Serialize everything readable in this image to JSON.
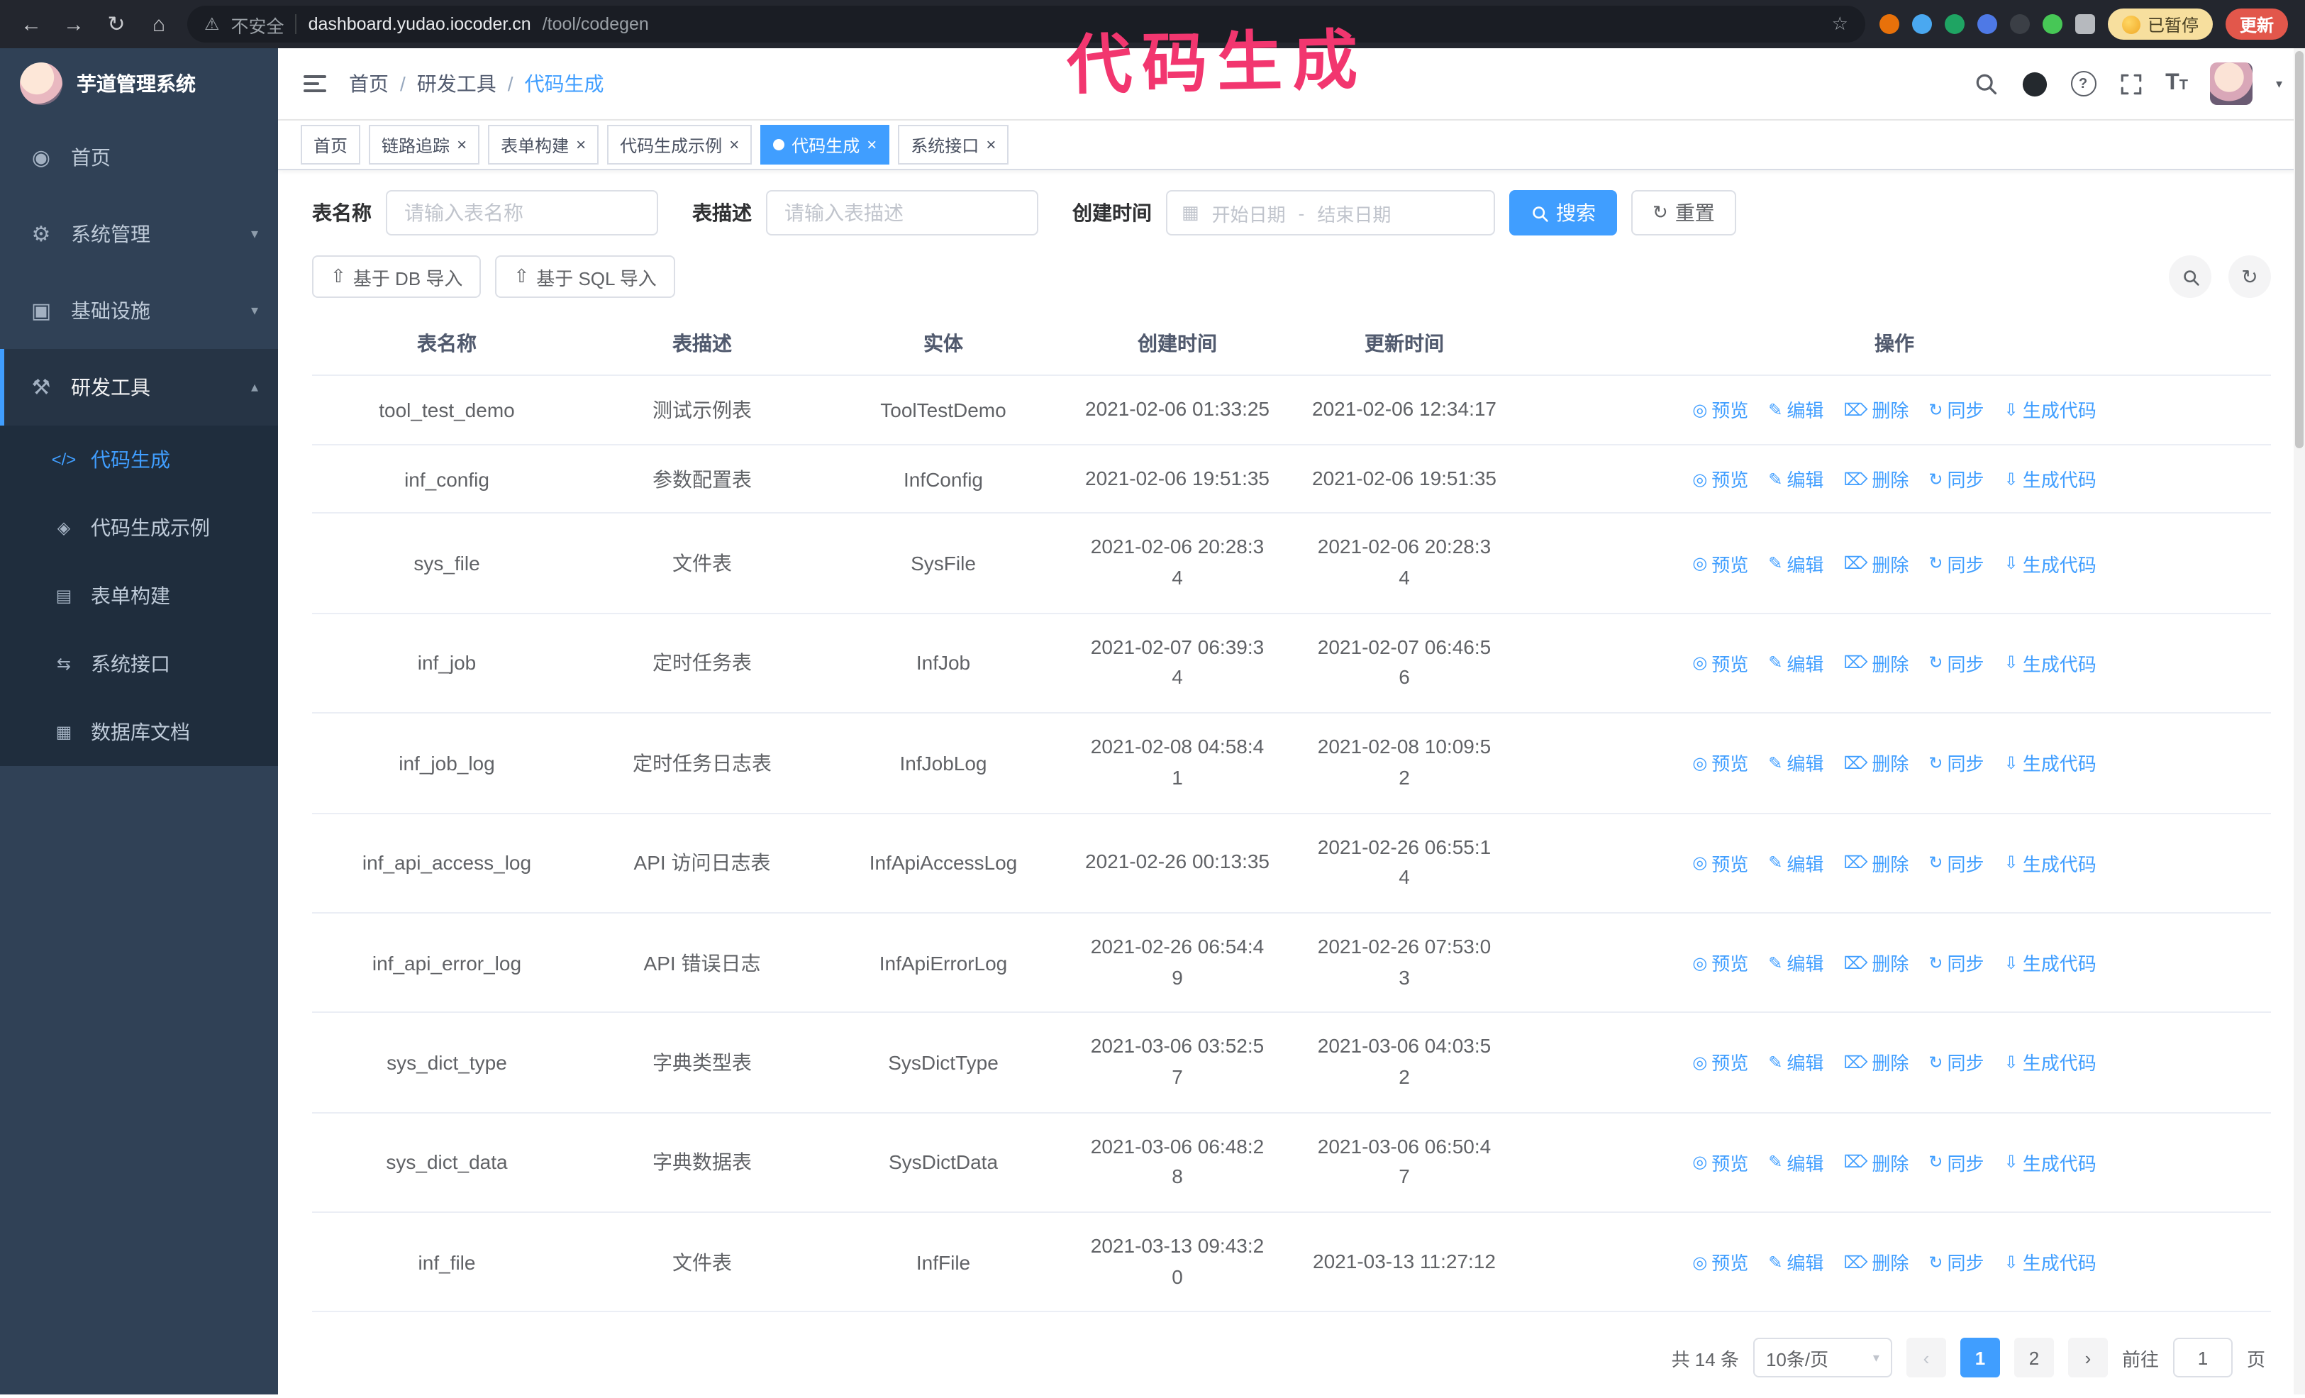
{
  "colors": {
    "primary": "#409eff",
    "annotation": "#f2366f",
    "sidebar_bg": "#304156",
    "submenu_bg": "#1f2d3d"
  },
  "annotation": {
    "text": "代码生成"
  },
  "browser": {
    "security_label": "不安全",
    "url_domain": "dashboard.yudao.iocoder.cn",
    "url_path": "/tool/codegen",
    "paused_badge": "已暂停",
    "update_button": "更新"
  },
  "sidebar": {
    "logo_title": "芋道管理系统",
    "items": [
      {
        "label": "首页"
      },
      {
        "label": "系统管理"
      },
      {
        "label": "基础设施"
      },
      {
        "label": "研发工具",
        "children": [
          {
            "label": "代码生成"
          },
          {
            "label": "代码生成示例"
          },
          {
            "label": "表单构建"
          },
          {
            "label": "系统接口"
          },
          {
            "label": "数据库文档"
          }
        ]
      }
    ]
  },
  "header": {
    "breadcrumb": [
      "首页",
      "研发工具",
      "代码生成"
    ],
    "separator": "/"
  },
  "tabs": [
    {
      "label": "首页"
    },
    {
      "label": "链路追踪"
    },
    {
      "label": "表单构建"
    },
    {
      "label": "代码生成示例"
    },
    {
      "label": "代码生成"
    },
    {
      "label": "系统接口"
    }
  ],
  "filters": {
    "table_name_label": "表名称",
    "table_name_placeholder": "请输入表名称",
    "table_desc_label": "表描述",
    "table_desc_placeholder": "请输入表描述",
    "create_time_label": "创建时间",
    "date_start_placeholder": "开始日期",
    "date_separator": "-",
    "date_end_placeholder": "结束日期",
    "search_button": "搜索",
    "reset_button": "重置"
  },
  "toolbar": {
    "import_db_label": "基于 DB 导入",
    "import_sql_label": "基于 SQL 导入"
  },
  "table": {
    "columns": [
      "表名称",
      "表描述",
      "实体",
      "创建时间",
      "更新时间",
      "操作"
    ],
    "actions": [
      {
        "name": "preview",
        "label": "预览",
        "icon": "eye-icon"
      },
      {
        "name": "edit",
        "label": "编辑",
        "icon": "edit-icon"
      },
      {
        "name": "delete",
        "label": "删除",
        "icon": "delete-icon"
      },
      {
        "name": "sync",
        "label": "同步",
        "icon": "sync-icon"
      },
      {
        "name": "generate-code",
        "label": "生成代码",
        "icon": "download-icon"
      }
    ],
    "rows": [
      {
        "name": "tool_test_demo",
        "desc": "测试示例表",
        "entity": "ToolTestDemo",
        "created": "2021-02-06 01:33:25",
        "updated": "2021-02-06 12:34:17"
      },
      {
        "name": "inf_config",
        "desc": "参数配置表",
        "entity": "InfConfig",
        "created": "2021-02-06 19:51:35",
        "updated": "2021-02-06 19:51:35"
      },
      {
        "name": "sys_file",
        "desc": "文件表",
        "entity": "SysFile",
        "created": "2021-02-06 20:28:3\n4",
        "updated": "2021-02-06 20:28:3\n4"
      },
      {
        "name": "inf_job",
        "desc": "定时任务表",
        "entity": "InfJob",
        "created": "2021-02-07 06:39:3\n4",
        "updated": "2021-02-07 06:46:5\n6"
      },
      {
        "name": "inf_job_log",
        "desc": "定时任务日志表",
        "entity": "InfJobLog",
        "created": "2021-02-08 04:58:4\n1",
        "updated": "2021-02-08 10:09:5\n2"
      },
      {
        "name": "inf_api_access_log",
        "desc": "API 访问日志表",
        "entity": "InfApiAccessLog",
        "created": "2021-02-26 00:13:35",
        "updated": "2021-02-26 06:55:1\n4"
      },
      {
        "name": "inf_api_error_log",
        "desc": "API 错误日志",
        "entity": "InfApiErrorLog",
        "created": "2021-02-26 06:54:4\n9",
        "updated": "2021-02-26 07:53:0\n3"
      },
      {
        "name": "sys_dict_type",
        "desc": "字典类型表",
        "entity": "SysDictType",
        "created": "2021-03-06 03:52:5\n7",
        "updated": "2021-03-06 04:03:5\n2"
      },
      {
        "name": "sys_dict_data",
        "desc": "字典数据表",
        "entity": "SysDictData",
        "created": "2021-03-06 06:48:2\n8",
        "updated": "2021-03-06 06:50:4\n7"
      },
      {
        "name": "inf_file",
        "desc": "文件表",
        "entity": "InfFile",
        "created": "2021-03-13 09:43:2\n0",
        "updated": "2021-03-13 11:27:12"
      }
    ]
  },
  "pagination": {
    "total_label": "共 14 条",
    "page_size": "10条/页",
    "pages": [
      "1",
      "2"
    ],
    "goto_prefix": "前往",
    "goto_value": "1",
    "goto_suffix": "页"
  }
}
